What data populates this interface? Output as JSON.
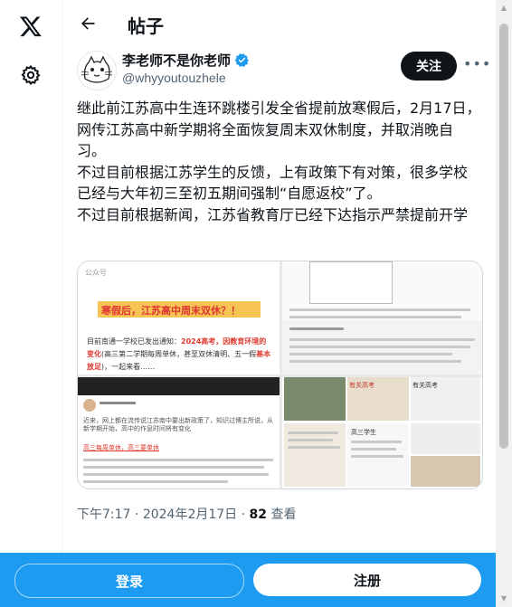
{
  "rail": {
    "logo": "x-logo-icon",
    "settings": "gear-icon"
  },
  "header": {
    "title": "帖子"
  },
  "author": {
    "name": "李老师不是你老师",
    "handle": "@whyyoutouzhele",
    "follow_label": "关注",
    "more_label": "•••"
  },
  "post": {
    "text": "继此前江苏高中生连环跳楼引发全省提前放寒假后，2月17日，网传江苏高中新学期将全面恢复周末双休制度，并取消晚自习。\n不过目前根据江苏学生的反馈，上有政策下有对策，很多学校已经与大年初三至初五期间强制“自愿返校”了。\n不过目前根据新闻，江苏省教育厅已经下达指示严禁提前开学"
  },
  "media": {
    "source_label": "公众号",
    "headline": "寒假后，江苏高中周末双休？！",
    "caption_prefix": "目前南通一学校已发出通知：",
    "caption_highlight": "2024高考，因教育环境的变化",
    "caption_mid": "(高三第二学期每周单休，甚至双休清明、五一假",
    "caption_highlight2": "基本放足",
    "caption_suffix": ")，一起来看……",
    "quote_caption": "近来，网上都在流传说江苏南中要出新政策了，知识过博主所说，从新学期开始，高中的作息时间将有变化",
    "quote_highlight": "高三每周单休，高三要单休",
    "right_heading_1": "有关高考",
    "right_heading_2": "有关高考",
    "rb_heading": "高三学生"
  },
  "meta": {
    "time": "下午7:17",
    "date": "2024年2月17日",
    "views": "82",
    "views_label": "查看"
  },
  "bottom": {
    "login_label": "登录",
    "signup_label": "注册"
  },
  "colors": {
    "brand": "#1d9bf0",
    "verified": "#1d9bf0",
    "text": "#0f1419",
    "muted": "#536471",
    "highlight_red": "#e03a2e"
  }
}
